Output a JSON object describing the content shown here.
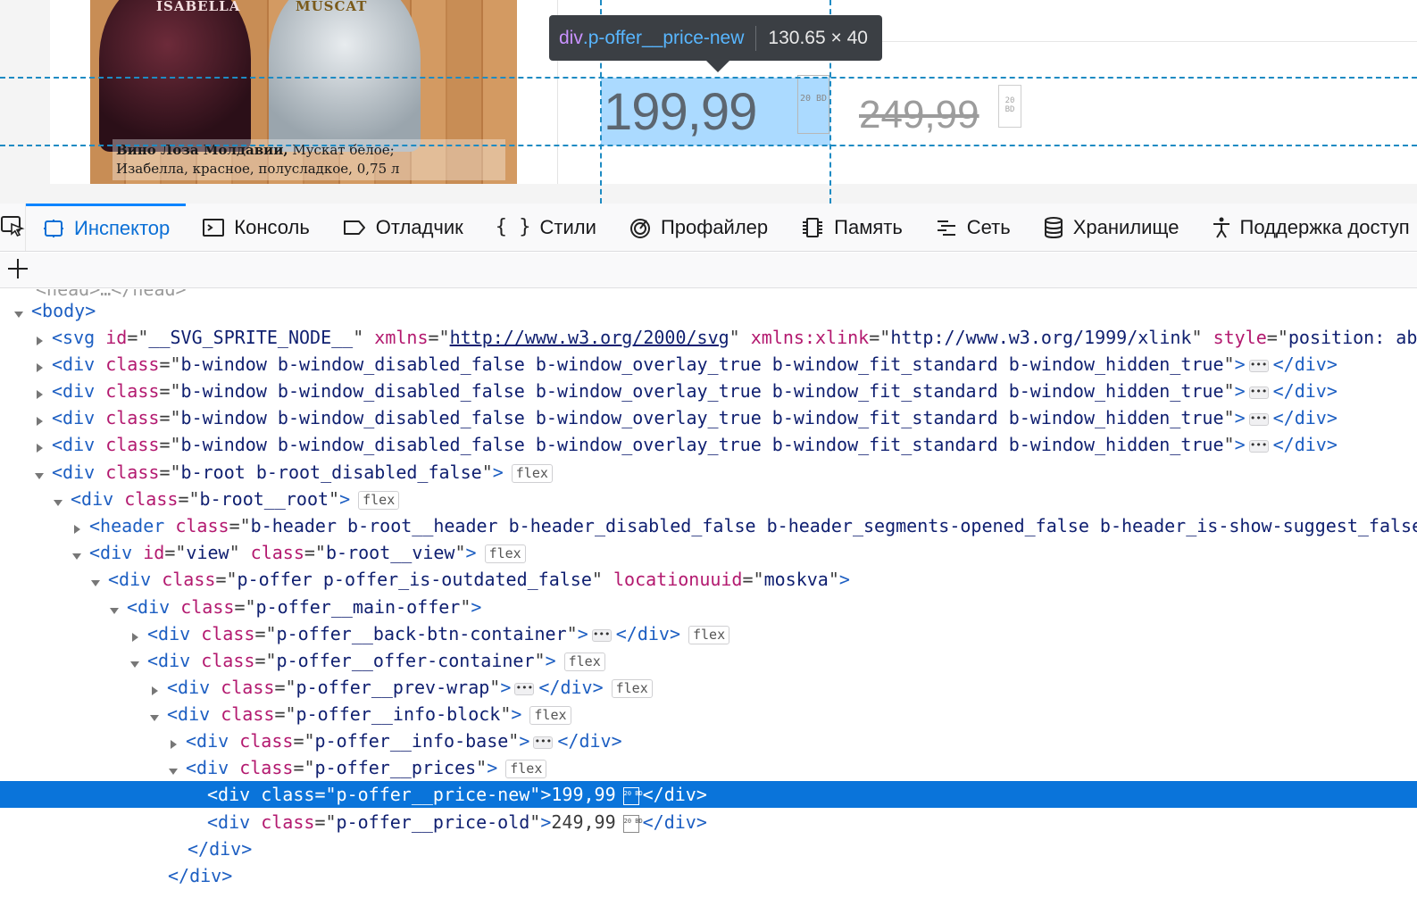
{
  "preview": {
    "bottle_left_label": "ISABELLA",
    "bottle_right_label": "MUSCAT",
    "caption_bold": "Вино Лоза Молдавии,",
    "caption_line1_rest": " Мускат белое;",
    "caption_line2": "Изабелла, красное, полусладкое, 0,75 л",
    "price_new": "199,99",
    "price_old": "249,99",
    "currency_glyph": "20 BD"
  },
  "tooltip": {
    "tag": "div",
    "class": ".p-offer__price-new",
    "dimensions": "130.65 × 40"
  },
  "toolbar": {
    "tabs": [
      {
        "label": "Инспектор",
        "icon": "inspector-icon",
        "selected": true
      },
      {
        "label": "Консоль",
        "icon": "console-icon"
      },
      {
        "label": "Отладчик",
        "icon": "debugger-icon"
      },
      {
        "label": "Стили",
        "icon": "style-editor-icon"
      },
      {
        "label": "Профайлер",
        "icon": "profiler-icon"
      },
      {
        "label": "Память",
        "icon": "memory-icon"
      },
      {
        "label": "Сеть",
        "icon": "network-icon"
      },
      {
        "label": "Хранилище",
        "icon": "storage-icon"
      },
      {
        "label": "Поддержка доступ",
        "icon": "accessibility-icon"
      }
    ]
  },
  "markup": {
    "top_cut": "<head>…</head>",
    "body_open": "body",
    "svg": {
      "tag": "svg",
      "id_attr": "id",
      "id": "__SVG_SPRITE_NODE__",
      "xmlns_attr": "xmlns",
      "xmlns": "http://www.w3.org/2000/svg",
      "xlink_attr": "xmlns:xlink",
      "xlink": "http://www.w3.org/1999/xlink",
      "style_attr": "style",
      "style": "position: ab"
    },
    "window_class": "b-window b-window_disabled_false b-window_overlay_true b-window_fit_standard b-window_hidden_true",
    "root_class": "b-root b-root_disabled_false",
    "root_root_class": "b-root__root",
    "header_class": "b-header b-root__header b-header_disabled_false b-header_segments-opened_false b-header_is-show-suggest_false",
    "view_id": "view",
    "view_class": "b-root__view",
    "offer_class": "p-offer p-offer_is-outdated_false",
    "offer_loc_attr": "locationuuid",
    "offer_loc": "moskva",
    "main_offer_class": "p-offer__main-offer",
    "back_btn_class": "p-offer__back-btn-container",
    "offer_container_class": "p-offer__offer-container",
    "prev_wrap_class": "p-offer__prev-wrap",
    "info_block_class": "p-offer__info-block",
    "info_base_class": "p-offer__info-base",
    "prices_class": "p-offer__prices",
    "price_new_class": "p-offer__price-new",
    "price_new_text": "199,99",
    "price_old_class": "p-offer__price-old",
    "price_old_text": "249,99",
    "flex_badge": "flex",
    "tag_div": "div",
    "tag_header": "header",
    "attr_class": "class",
    "attr_id": "id",
    "close_div": "</div>"
  }
}
